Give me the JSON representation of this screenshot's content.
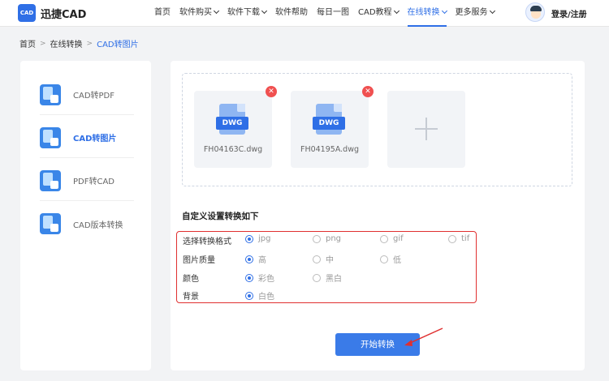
{
  "header": {
    "logo_text": "CAD",
    "brand": "迅捷CAD",
    "nav": [
      {
        "label": "首页",
        "dropdown": false,
        "active": false
      },
      {
        "label": "软件购买",
        "dropdown": true,
        "active": false
      },
      {
        "label": "软件下载",
        "dropdown": true,
        "active": false
      },
      {
        "label": "软件帮助",
        "dropdown": false,
        "active": false
      },
      {
        "label": "每日一图",
        "dropdown": false,
        "active": false
      },
      {
        "label": "CAD教程",
        "dropdown": true,
        "active": false
      },
      {
        "label": "在线转换",
        "dropdown": true,
        "active": true
      },
      {
        "label": "更多服务",
        "dropdown": true,
        "active": false
      }
    ],
    "login": "登录/注册"
  },
  "breadcrumb": {
    "items": [
      "首页",
      "在线转换",
      "CAD转图片"
    ]
  },
  "sidebar": {
    "items": [
      {
        "label": "CAD转PDF",
        "icon": "cad-to-pdf-icon",
        "active": false
      },
      {
        "label": "CAD转图片",
        "icon": "cad-to-image-icon",
        "active": true
      },
      {
        "label": "PDF转CAD",
        "icon": "pdf-to-cad-icon",
        "active": false
      },
      {
        "label": "CAD版本转换",
        "icon": "cad-version-icon",
        "active": false
      }
    ]
  },
  "upload": {
    "files": [
      {
        "name": "FH04163C.dwg",
        "type": "DWG"
      },
      {
        "name": "FH04195A.dwg",
        "type": "DWG"
      }
    ],
    "remove_glyph": "✕",
    "add_icon": "plus-icon"
  },
  "settings": {
    "title": "自定义设置转换如下",
    "rows": [
      {
        "label": "选择转换格式",
        "options": [
          "jpg",
          "png",
          "gif",
          "tif"
        ],
        "selected": "jpg"
      },
      {
        "label": "图片质量",
        "options": [
          "高",
          "中",
          "低"
        ],
        "selected": "高"
      },
      {
        "label": "颜色",
        "options": [
          "彩色",
          "黑白"
        ],
        "selected": "彩色"
      },
      {
        "label": "背景",
        "options": [
          "白色"
        ],
        "selected": "白色"
      }
    ]
  },
  "start_button": "开始转换",
  "colors": {
    "accent": "#2f6fe6",
    "highlight_box": "#e03030",
    "remove": "#f05050"
  }
}
